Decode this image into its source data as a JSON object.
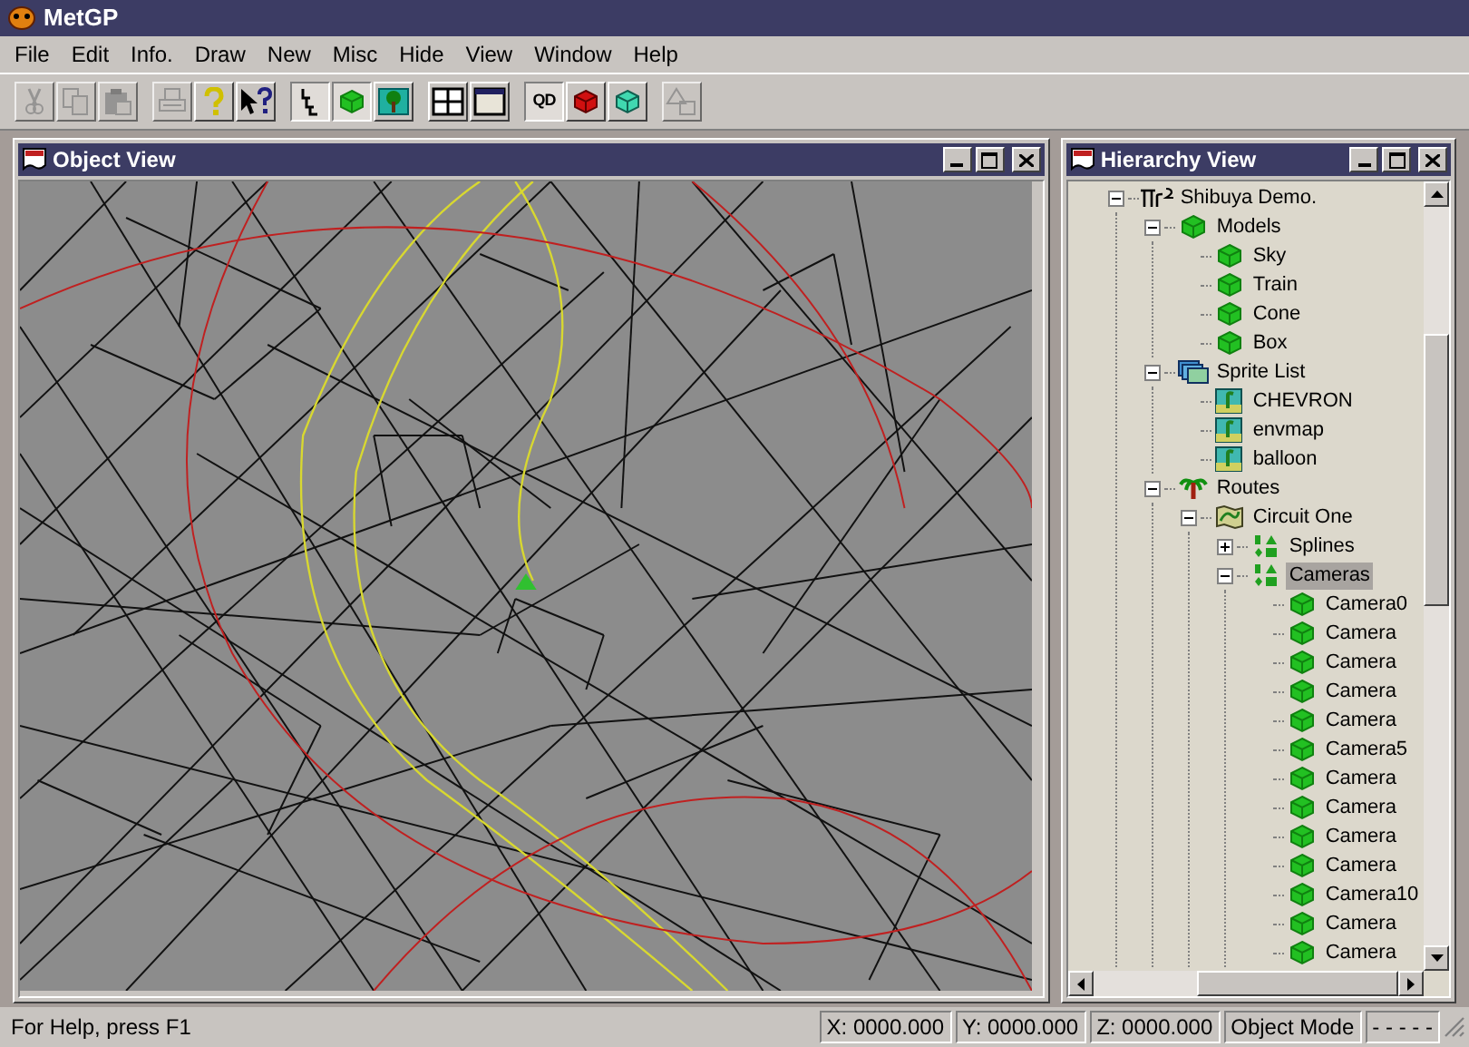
{
  "window": {
    "title": "MetGP"
  },
  "menu": [
    "File",
    "Edit",
    "Info.",
    "Draw",
    "New",
    "Misc",
    "Hide",
    "View",
    "Window",
    "Help"
  ],
  "toolbar_groups": [
    [
      {
        "kind": "cut",
        "pressed": false,
        "disabled": true
      },
      {
        "kind": "copy",
        "pressed": false,
        "disabled": true
      },
      {
        "kind": "paste",
        "pressed": false,
        "disabled": true
      }
    ],
    [
      {
        "kind": "print",
        "pressed": false,
        "disabled": true
      },
      {
        "kind": "help",
        "pressed": false,
        "disabled": false
      },
      {
        "kind": "context-help",
        "pressed": false,
        "disabled": false
      }
    ],
    [
      {
        "kind": "select",
        "pressed": true,
        "disabled": false
      },
      {
        "kind": "cube",
        "pressed": true,
        "disabled": false
      },
      {
        "kind": "picture",
        "pressed": false,
        "disabled": false
      }
    ],
    [
      {
        "kind": "split",
        "pressed": false,
        "disabled": false
      },
      {
        "kind": "single",
        "pressed": false,
        "disabled": false
      }
    ],
    [
      {
        "kind": "text",
        "label": "QD",
        "pressed": true,
        "disabled": false
      },
      {
        "kind": "red-cube",
        "pressed": false,
        "disabled": false
      },
      {
        "kind": "cyan-cube",
        "pressed": false,
        "disabled": false
      }
    ],
    [
      {
        "kind": "shapes",
        "pressed": false,
        "disabled": true
      }
    ]
  ],
  "object_view": {
    "title": "Object View"
  },
  "hierarchy_view": {
    "title": "Hierarchy View",
    "tree": [
      {
        "label": "Shibuya Demo.",
        "kind": "scene",
        "expanded": true,
        "selected": false,
        "children": [
          {
            "label": "Models",
            "kind": "cube",
            "expanded": true,
            "selected": false,
            "children": [
              {
                "label": "Sky",
                "kind": "cube",
                "selected": false
              },
              {
                "label": "Train",
                "kind": "cube",
                "selected": false
              },
              {
                "label": "Cone",
                "kind": "cube",
                "selected": false
              },
              {
                "label": "Box",
                "kind": "cube",
                "selected": false
              }
            ]
          },
          {
            "label": "Sprite List",
            "kind": "sprites",
            "expanded": true,
            "selected": false,
            "children": [
              {
                "label": "CHEVRON",
                "kind": "sprite",
                "selected": false
              },
              {
                "label": "envmap",
                "kind": "sprite",
                "selected": false
              },
              {
                "label": "balloon",
                "kind": "sprite",
                "selected": false
              }
            ]
          },
          {
            "label": "Routes",
            "kind": "tree",
            "expanded": true,
            "selected": false,
            "children": [
              {
                "label": "Circuit One",
                "kind": "route",
                "expanded": true,
                "selected": false,
                "children": [
                  {
                    "label": "Splines",
                    "kind": "shapes",
                    "expanded": false,
                    "selected": false
                  },
                  {
                    "label": "Cameras",
                    "kind": "shapes",
                    "expanded": true,
                    "selected": true,
                    "children": [
                      {
                        "label": "Camera0",
                        "kind": "camera",
                        "selected": false
                      },
                      {
                        "label": "Camera",
                        "kind": "camera",
                        "selected": false
                      },
                      {
                        "label": "Camera",
                        "kind": "camera",
                        "selected": false
                      },
                      {
                        "label": "Camera",
                        "kind": "camera",
                        "selected": false
                      },
                      {
                        "label": "Camera",
                        "kind": "camera",
                        "selected": false
                      },
                      {
                        "label": "Camera5",
                        "kind": "camera",
                        "selected": false
                      },
                      {
                        "label": "Camera",
                        "kind": "camera",
                        "selected": false
                      },
                      {
                        "label": "Camera",
                        "kind": "camera",
                        "selected": false
                      },
                      {
                        "label": "Camera",
                        "kind": "camera",
                        "selected": false
                      },
                      {
                        "label": "Camera",
                        "kind": "camera",
                        "selected": false
                      },
                      {
                        "label": "Camera10",
                        "kind": "camera",
                        "selected": false
                      },
                      {
                        "label": "Camera",
                        "kind": "camera",
                        "selected": false
                      },
                      {
                        "label": "Camera",
                        "kind": "camera",
                        "selected": false
                      }
                    ]
                  }
                ]
              }
            ]
          }
        ]
      }
    ]
  },
  "status_bar": {
    "help": "For Help, press F1",
    "panes": [
      "X: 0000.000",
      "Y: 0000.000",
      "Z: 0000.000",
      "Object Mode",
      "- - - - -"
    ]
  }
}
